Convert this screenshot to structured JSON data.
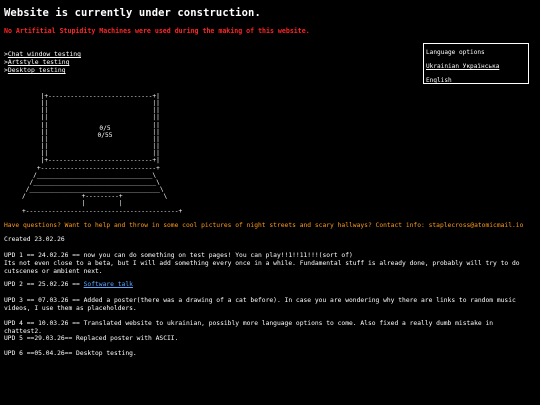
{
  "page": {
    "title": "Website is currently under construction.",
    "subtitle": "No Artifitial Stupidity Machines were used during the making of this website."
  },
  "nav": [
    {
      "label": "Chat window testing"
    },
    {
      "label": "Artstyle testing"
    },
    {
      "label": "Desktop testing"
    }
  ],
  "language_box": {
    "heading": "Language options",
    "options": [
      "Ukrainian Українська",
      "English"
    ]
  },
  "terminal": {
    "score_line1": "0/5",
    "score_line2": "0/55"
  },
  "contact": "Have questions? Want to help and throw in some cool pictures of night streets and scary hallways? Contact info: staplecross@atomicmail.io",
  "created": "Created 23.02.26",
  "updates": [
    {
      "text": "UPD 1 == 24.02.26 == now you can do something on test pages! You can play!!1!!11!!!(sort of)\nIts not even close to a beta, but I will add something every once in a while. Fundamental stuff is already done, probably will try to do cutscenes or ambient next."
    },
    {
      "prefix": "UPD 2 == 25.02.26 == ",
      "link": "Software talk"
    },
    {
      "text": "UPD 3 == 07.03.26 == Added a poster(there was a drawing of a cat before). In case you are wondering why there are links to random music videos, I use them as placeholders."
    },
    {
      "text": "UPD 4 == 10.03.26 == Translated website to ukrainian, possibly more language options to come. Also fixed a really dumb mistake in chattest2."
    },
    {
      "text": "UPD 5 ==29.03.26== Replaced poster with ASCII."
    },
    {
      "text": "UPD 6 ==05.04.26== Desktop testing."
    }
  ],
  "colors": {
    "background": "#000000",
    "text": "#ffffff",
    "warning_red": "#ff2424",
    "contact_orange": "#ff9a1a",
    "link_blue": "#5aa8ff"
  }
}
